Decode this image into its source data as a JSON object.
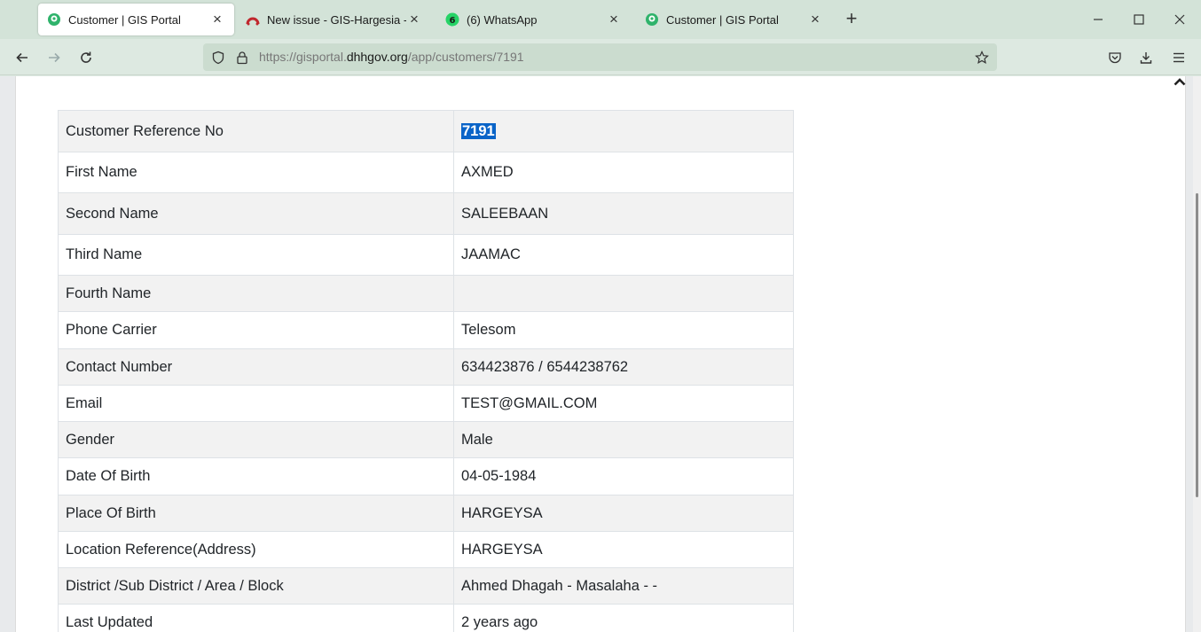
{
  "browser": {
    "tabs": [
      {
        "title": "Customer | GIS Portal",
        "active": true,
        "icon": "gis-portal-icon"
      },
      {
        "title": "New issue - GIS-Hargesia - Team",
        "active": false,
        "icon": "redmine-icon"
      },
      {
        "title": "(6) WhatsApp",
        "active": false,
        "icon": "whatsapp-icon",
        "badge": "6"
      },
      {
        "title": "Customer | GIS Portal",
        "active": false,
        "icon": "gis-portal-icon"
      }
    ],
    "url_prefix": "https://gisportal.",
    "url_host": "dhhgov.org",
    "url_path": "/app/customers/7191"
  },
  "customer": {
    "rows": [
      {
        "label": "Customer Reference No",
        "value": "7191"
      },
      {
        "label": "First Name",
        "value": "AXMED"
      },
      {
        "label": "Second Name",
        "value": "SALEEBAAN"
      },
      {
        "label": "Third Name",
        "value": "JAAMAC"
      },
      {
        "label": "Fourth Name",
        "value": ""
      },
      {
        "label": "Phone Carrier",
        "value": "Telesom"
      },
      {
        "label": "Contact Number",
        "value": "634423876 / 6544238762"
      },
      {
        "label": "Email",
        "value": "TEST@GMAIL.COM"
      },
      {
        "label": "Gender",
        "value": "Male"
      },
      {
        "label": "Date Of Birth",
        "value": "04-05-1984"
      },
      {
        "label": "Place Of Birth",
        "value": "HARGEYSA"
      },
      {
        "label": "Location Reference(Address)",
        "value": "HARGEYSA"
      },
      {
        "label": "District /Sub District / Area / Block",
        "value": "Ahmed Dhagah - Masalaha - -"
      },
      {
        "label": "Last Updated",
        "value": "2 years ago"
      }
    ]
  },
  "colors": {
    "tabstrip": "#d3e3d8",
    "selection": "#0a64c8",
    "whatsapp": "#25d366"
  }
}
